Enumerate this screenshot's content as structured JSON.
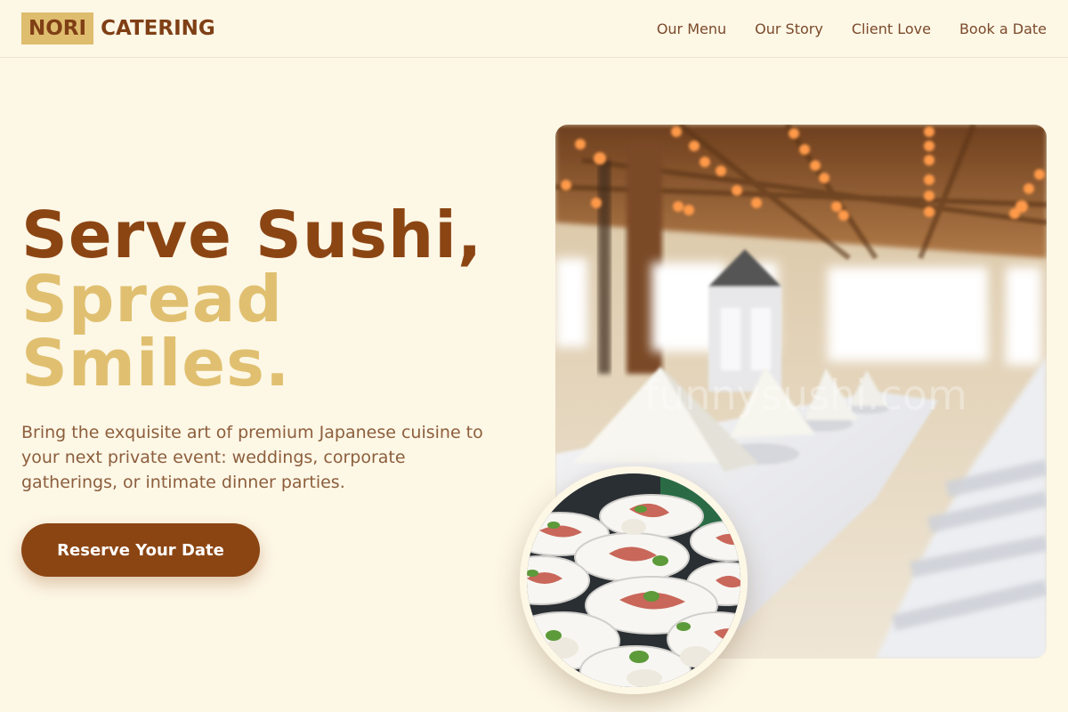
{
  "brand": {
    "part1": "NORI",
    "part2": "CATERING"
  },
  "nav": [
    {
      "label": "Our Menu"
    },
    {
      "label": "Our Story"
    },
    {
      "label": "Client Love"
    },
    {
      "label": "Book a Date"
    }
  ],
  "hero": {
    "line1": "Serve Sushi,",
    "line2": "Spread",
    "line3": "Smiles.",
    "description": "Bring the exquisite art of premium Japanese cuisine to your next private event: weddings, corporate gatherings, or intimate dinner parties.",
    "cta": "Reserve Your Date"
  },
  "watermark": "funnysushi.com",
  "colors": {
    "brown": "#8b4513",
    "gold": "#e0c070",
    "background": "#fdf7e6"
  }
}
